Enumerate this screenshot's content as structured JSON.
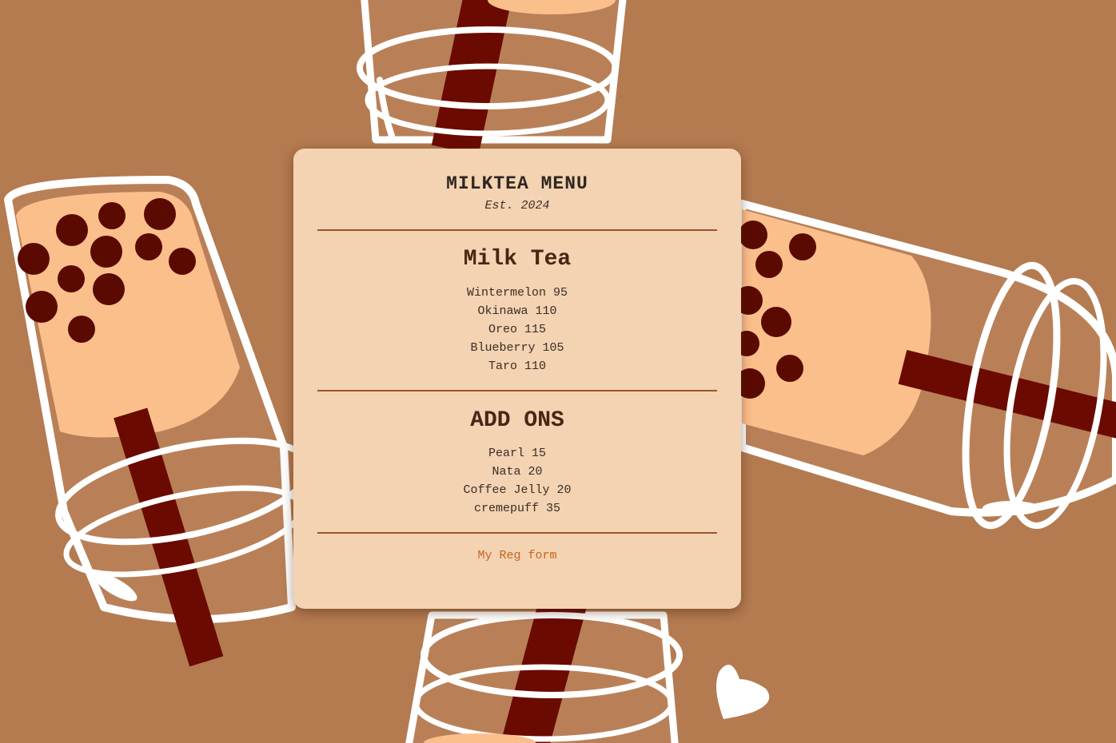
{
  "menu": {
    "title": "MILKTEA MENU",
    "established": "Est. 2024"
  },
  "sections": [
    {
      "title": "Milk Tea",
      "items": [
        "Wintermelon 95",
        "Okinawa 110",
        "Oreo 115",
        "Blueberry 105",
        "Taro 110"
      ]
    },
    {
      "title": "ADD ONS",
      "items": [
        "Pearl 15",
        "Nata 20",
        "Coffee Jelly 20",
        "cremepuff 35"
      ]
    }
  ],
  "footer": {
    "link_label": "My Reg form"
  },
  "colors": {
    "background": "#b47a50",
    "card": "#f3d3b1",
    "divider": "#a0522d",
    "link": "#c4661f",
    "straw": "#6b0a00",
    "pearl": "#5a0a00",
    "tea": "#fbbf8c"
  }
}
